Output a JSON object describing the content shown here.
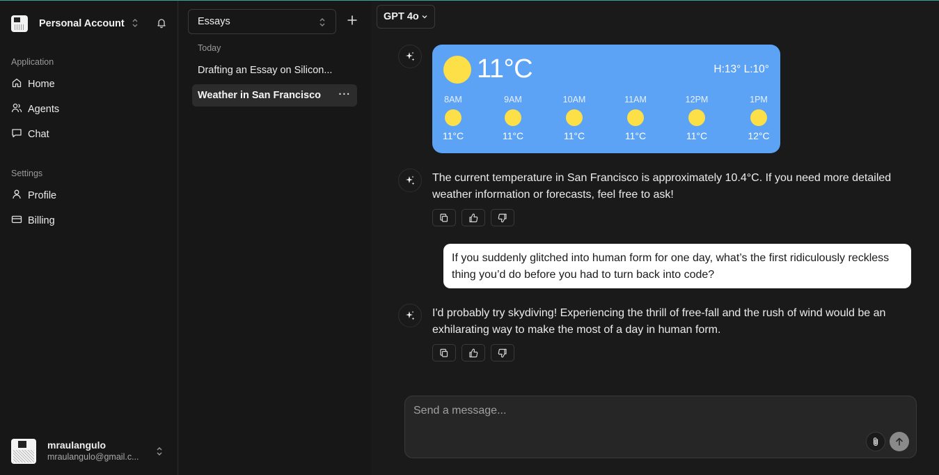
{
  "account": {
    "name": "Personal Account"
  },
  "sidebar": {
    "sections": [
      {
        "label": "Application",
        "items": [
          {
            "label": "Home",
            "icon": "home-icon"
          },
          {
            "label": "Agents",
            "icon": "users-icon"
          },
          {
            "label": "Chat",
            "icon": "message-icon"
          }
        ]
      },
      {
        "label": "Settings",
        "items": [
          {
            "label": "Profile",
            "icon": "user-icon"
          },
          {
            "label": "Billing",
            "icon": "credit-card-icon"
          }
        ]
      }
    ]
  },
  "user": {
    "name": "mraulangulo",
    "email": "mraulangulo@gmail.c..."
  },
  "chatlist": {
    "folder": "Essays",
    "group_label": "Today",
    "items": [
      {
        "title": "Drafting an Essay on Silicon...",
        "active": false
      },
      {
        "title": "Weather in San Francisco",
        "active": true,
        "menu": "···"
      }
    ]
  },
  "model": {
    "label": "GPT 4o"
  },
  "weather": {
    "current_temp": "11°C",
    "high_low": "H:13° L:10°",
    "hourly": [
      {
        "time": "8AM",
        "temp": "11°C"
      },
      {
        "time": "9AM",
        "temp": "11°C"
      },
      {
        "time": "10AM",
        "temp": "11°C"
      },
      {
        "time": "11AM",
        "temp": "11°C"
      },
      {
        "time": "12PM",
        "temp": "11°C"
      },
      {
        "time": "1PM",
        "temp": "12°C"
      }
    ],
    "card_color": "#5ca3f5",
    "sun_color": "#fde047"
  },
  "messages": [
    {
      "role": "assistant",
      "text": "The current temperature in San Francisco is approximately 10.4°C. If you need more detailed weather information or forecasts, feel free to ask!"
    },
    {
      "role": "user",
      "text": "If you suddenly glitched into human form for one day, what’s the first ridiculously reckless thing you’d do before you had to turn back into code?"
    },
    {
      "role": "assistant",
      "text": "I'd probably try skydiving! Experiencing the thrill of free-fall and the rush of wind would be an exhilarating way to make the most of a day in human form."
    }
  ],
  "composer": {
    "placeholder": "Send a message..."
  }
}
